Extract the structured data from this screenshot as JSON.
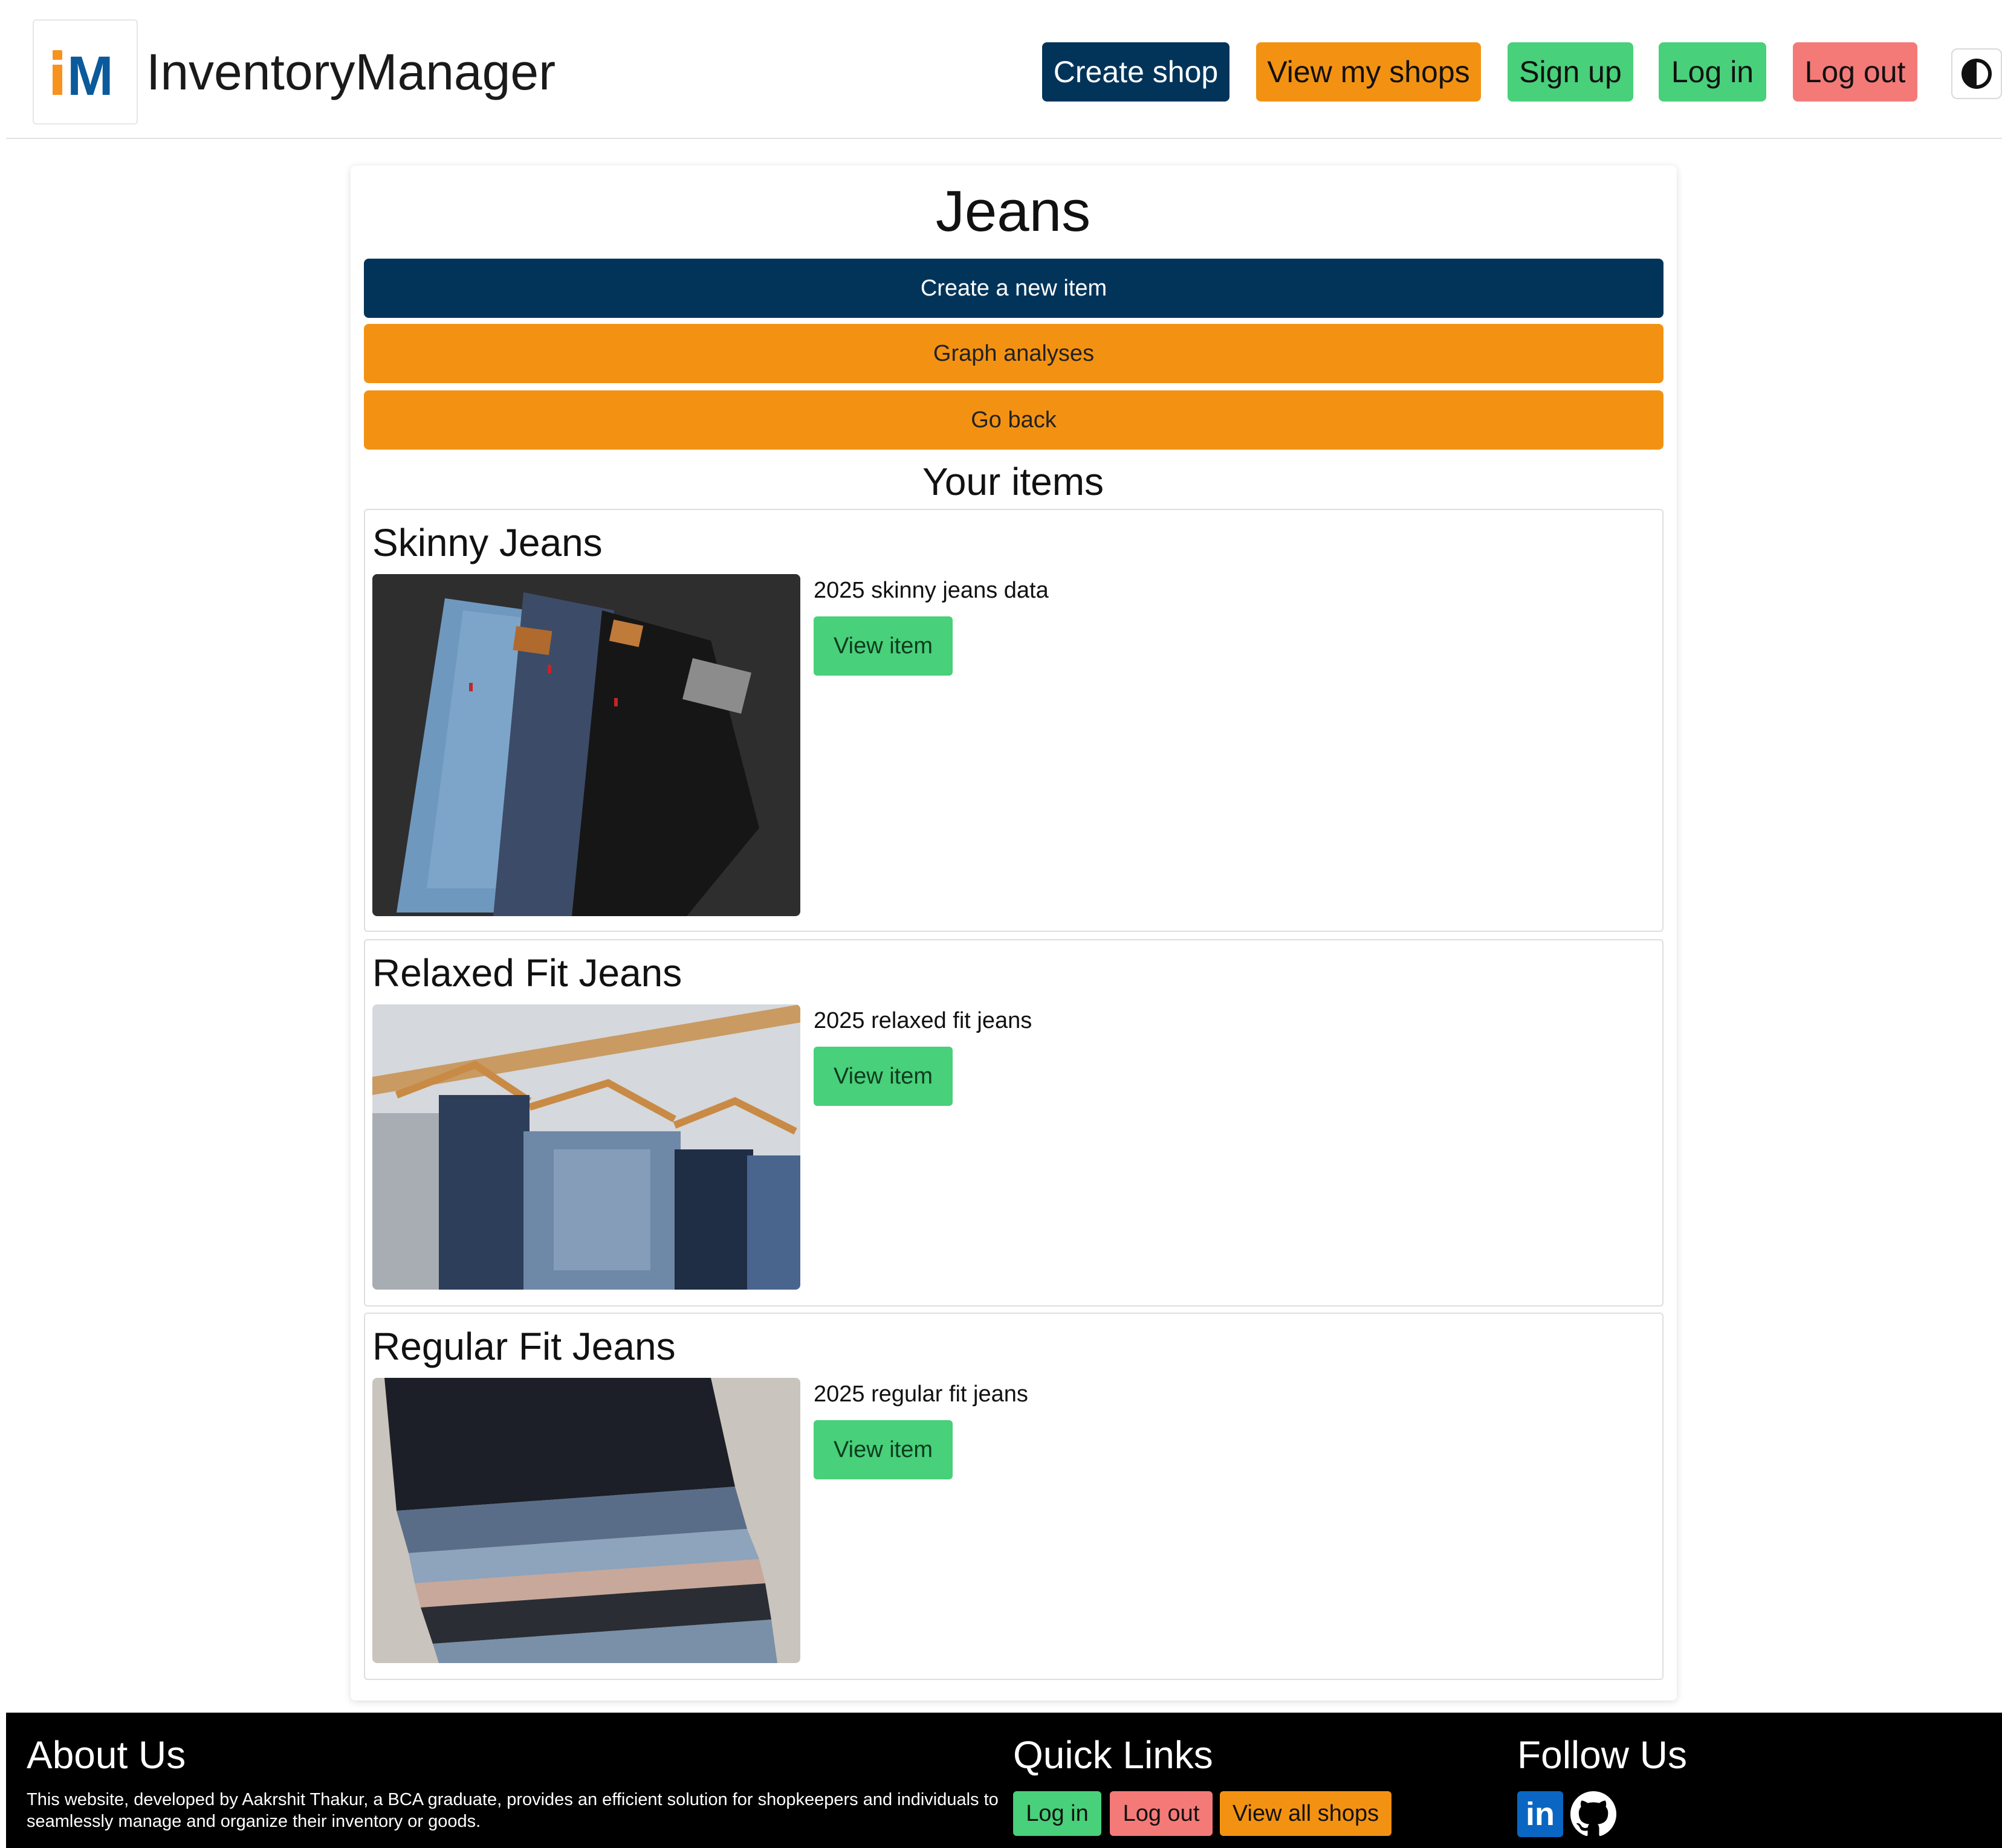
{
  "header": {
    "logo_text": "iM",
    "brand": "InventoryManager",
    "nav": {
      "create_shop": "Create shop",
      "view_my_shops": "View my shops",
      "sign_up": "Sign up",
      "log_in": "Log in",
      "log_out": "Log out"
    },
    "contrast_icon": "contrast-icon"
  },
  "main": {
    "title": "Jeans",
    "create_item": "Create a new item",
    "graph_analyses": "Graph analyses",
    "go_back": "Go back",
    "section_title": "Your items",
    "items": [
      {
        "name": "Skinny Jeans",
        "description": "2025 skinny jeans data",
        "action": "View item",
        "image": "skinny-jeans-photo"
      },
      {
        "name": "Relaxed Fit Jeans",
        "description": "2025 relaxed fit jeans",
        "action": "View item",
        "image": "relaxed-fit-jeans-photo"
      },
      {
        "name": "Regular Fit Jeans",
        "description": "2025 regular fit jeans",
        "action": "View item",
        "image": "regular-fit-jeans-photo"
      }
    ]
  },
  "footer": {
    "about_title": "About Us",
    "about_text": "This website, developed by Aakrshit Thakur, a BCA graduate, provides an efficient solution for shopkeepers and individuals to seamlessly manage and organize their inventory or goods.",
    "quick_links_title": "Quick Links",
    "quick_links": {
      "log_in": "Log in",
      "log_out": "Log out",
      "view_all_shops": "View all shops"
    },
    "follow_title": "Follow Us",
    "social": {
      "linkedin_label": "in",
      "linkedin_icon": "linkedin-icon",
      "github_icon": "github-icon"
    }
  },
  "colors": {
    "navy": "#02345a",
    "orange": "#f39212",
    "green": "#48d07a",
    "red": "#f47a78",
    "logo_orange": "#f7921e",
    "logo_blue": "#0a5a9c"
  }
}
